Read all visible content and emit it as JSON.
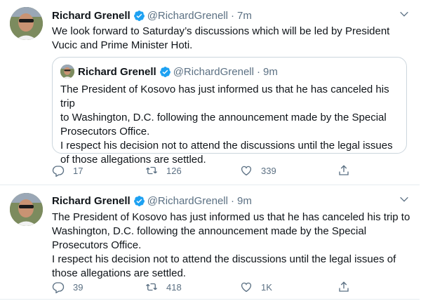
{
  "tweets": [
    {
      "name": "Richard Grenell",
      "handle": "@RichardGrenell",
      "time": "7m",
      "text": "We look forward to Saturday’s discussions which will be led by President\nVucic and Prime Minister Hoti.",
      "quote": {
        "name": "Richard Grenell",
        "handle": "@RichardGrenell",
        "time": "9m",
        "text": "The President of Kosovo has just informed us that he has canceled his trip\nto Washington, D.C. following the announcement made by the Special\nProsecutors Office.\nI respect his decision not to attend the discussions until the legal issues\nof those allegations are settled."
      },
      "replies": "17",
      "retweets": "126",
      "likes": "339"
    },
    {
      "name": "Richard Grenell",
      "handle": "@RichardGrenell",
      "time": "9m",
      "text": "The President of Kosovo has just informed us that he has canceled his trip to\nWashington, D.C. following the announcement made by the Special\nProsecutors Office.\nI respect his decision not to attend the discussions until the legal issues of\nthose allegations are settled.",
      "replies": "39",
      "retweets": "418",
      "likes": "1K"
    }
  ],
  "separator": "·",
  "colors": {
    "accent": "#1da1f2",
    "secondary_text": "#5b7083",
    "border": "#e6ecf0"
  },
  "icons": [
    "verified-badge-icon",
    "chevron-down-icon",
    "reply-icon",
    "retweet-icon",
    "like-icon",
    "share-icon"
  ]
}
